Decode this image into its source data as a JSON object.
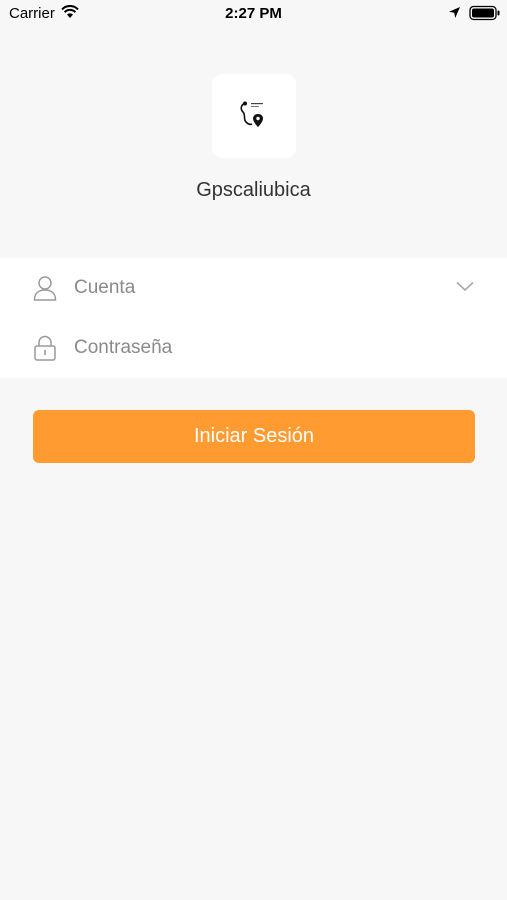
{
  "status_bar": {
    "carrier": "Carrier",
    "time": "2:27 PM"
  },
  "app": {
    "name": "Gpscaliubica",
    "logo_icon": "map-pin-logo"
  },
  "form": {
    "account_placeholder": "Cuenta",
    "password_placeholder": "Contraseña"
  },
  "login_button": {
    "label": "Iniciar Sesión"
  },
  "colors": {
    "accent": "#ff9b31",
    "background": "#f7f7f7"
  }
}
